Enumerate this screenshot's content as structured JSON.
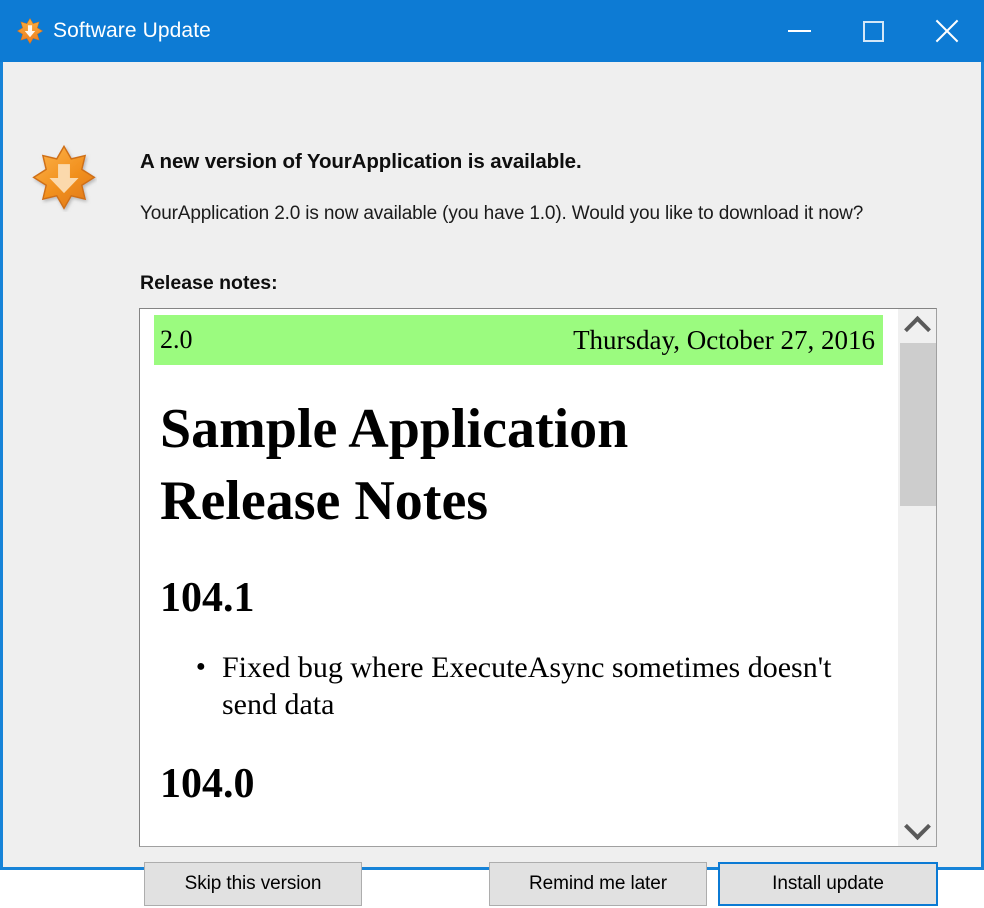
{
  "window": {
    "title": "Software Update",
    "icon": "update-star-icon",
    "accent_color": "#0d7bd4",
    "background_color": "#efefef",
    "controls": {
      "minimize_label": "Minimize",
      "maximize_label": "Maximize",
      "close_label": "Close"
    }
  },
  "main": {
    "hero_icon": "update-star-icon",
    "headline": "A new version of YourApplication is available.",
    "subtext": "YourApplication 2.0 is now available (you have 1.0). Would you like to download it now?",
    "notes_label": "Release notes:"
  },
  "release_notes": {
    "version_bar": {
      "version": "2.0",
      "date": "Thursday, October 27, 2016",
      "background_color": "#9bfb7f"
    },
    "document_title_line1": "Sample Application",
    "document_title_line2": "Release Notes",
    "sections": [
      {
        "version": "104.1",
        "items": [
          "Fixed bug where ExecuteAsync sometimes doesn't send data"
        ]
      },
      {
        "version": "104.0",
        "items": []
      }
    ]
  },
  "scrollbar": {
    "up_arrow": "chevron-up-icon",
    "down_arrow": "chevron-down-icon",
    "thumb_position_percent": 0,
    "thumb_size_percent": 35
  },
  "buttons": {
    "skip": "Skip this version",
    "remind": "Remind me later",
    "install": "Install update",
    "install_focus_color": "#0b7ad4"
  }
}
